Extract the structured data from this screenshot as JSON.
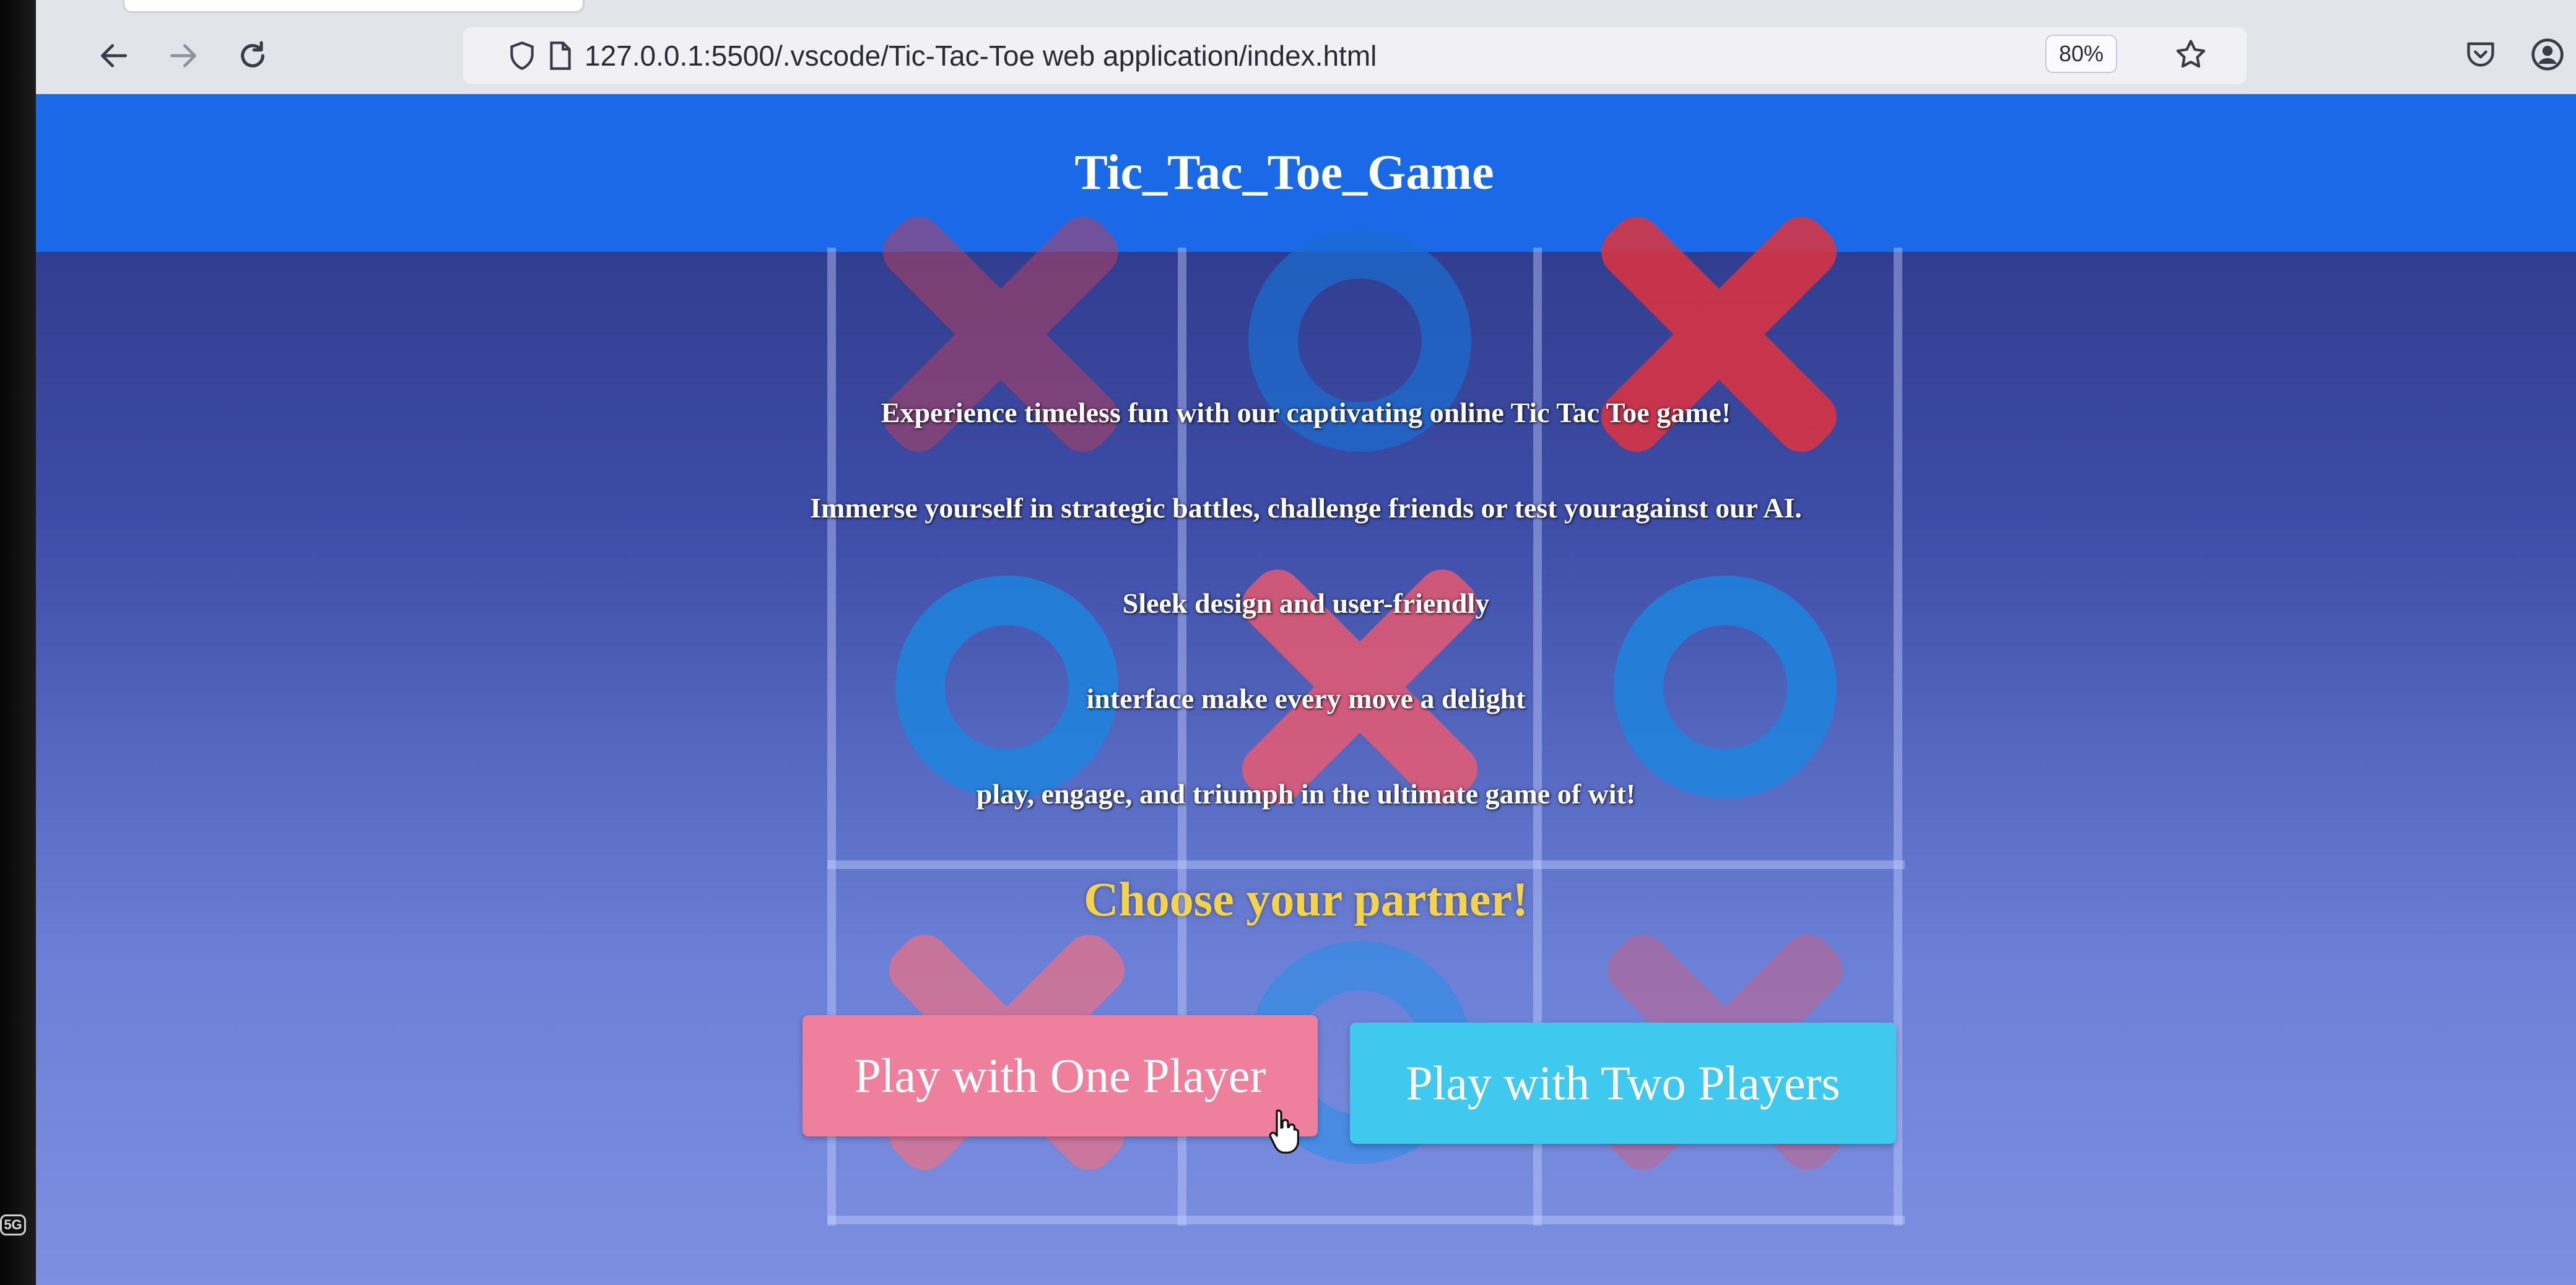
{
  "browser": {
    "url": "127.0.0.1:5500/.vscode/Tic-Tac-Toe web application/index.html",
    "zoom": "80%",
    "icons": {
      "back": "arrow-left-icon",
      "forward": "arrow-right-icon",
      "reload": "reload-icon",
      "shield": "shield-icon",
      "page": "page-icon",
      "bookmark": "star-icon",
      "pocket": "pocket-icon",
      "account": "account-icon"
    }
  },
  "page": {
    "title": "Tic_Tac_Toe_Game",
    "intro": [
      "Experience timeless fun with our captivating online Tic Tac Toe game!",
      "Immerse yourself in strategic battles, challenge friends or test youragainst our AI.",
      "Sleek design and user-friendly",
      "interface make every move a delight",
      "play, engage, and triumph in the ultimate game of wit!"
    ],
    "choose_heading": "Choose your partner!",
    "buttons": {
      "one_player": "Play with One Player",
      "two_players": "Play with Two Players"
    }
  },
  "device": {
    "bezel_badge": "5G"
  },
  "colors": {
    "header_bg": "#1a6ae8",
    "heading_yellow": "#f4d24a",
    "one_player_btn": "#ee7f9d",
    "two_players_btn": "#3fc9ee",
    "x_mark": "#e0505a",
    "o_mark": "#1a86e0"
  }
}
